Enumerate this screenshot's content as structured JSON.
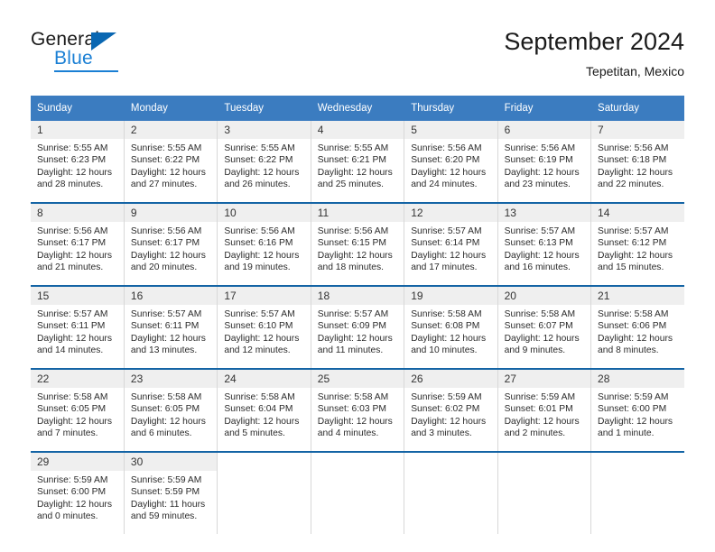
{
  "brand": {
    "name_top": "General",
    "name_bottom": "Blue",
    "triangle_color": "#0a67b2",
    "blue_color": "#1a7fd4"
  },
  "header": {
    "title": "September 2024",
    "subtitle": "Tepetitan, Mexico"
  },
  "theme": {
    "header_row_bg": "#3b7cc0",
    "header_row_text": "#ffffff",
    "week_divider": "#1464a5",
    "daynum_bg": "#efefef",
    "cell_border": "#d8d8d8"
  },
  "columns": [
    "Sunday",
    "Monday",
    "Tuesday",
    "Wednesday",
    "Thursday",
    "Friday",
    "Saturday"
  ],
  "weeks": [
    [
      {
        "day": "1",
        "sunrise": "Sunrise: 5:55 AM",
        "sunset": "Sunset: 6:23 PM",
        "daylight_1": "Daylight: 12 hours",
        "daylight_2": "and 28 minutes."
      },
      {
        "day": "2",
        "sunrise": "Sunrise: 5:55 AM",
        "sunset": "Sunset: 6:22 PM",
        "daylight_1": "Daylight: 12 hours",
        "daylight_2": "and 27 minutes."
      },
      {
        "day": "3",
        "sunrise": "Sunrise: 5:55 AM",
        "sunset": "Sunset: 6:22 PM",
        "daylight_1": "Daylight: 12 hours",
        "daylight_2": "and 26 minutes."
      },
      {
        "day": "4",
        "sunrise": "Sunrise: 5:55 AM",
        "sunset": "Sunset: 6:21 PM",
        "daylight_1": "Daylight: 12 hours",
        "daylight_2": "and 25 minutes."
      },
      {
        "day": "5",
        "sunrise": "Sunrise: 5:56 AM",
        "sunset": "Sunset: 6:20 PM",
        "daylight_1": "Daylight: 12 hours",
        "daylight_2": "and 24 minutes."
      },
      {
        "day": "6",
        "sunrise": "Sunrise: 5:56 AM",
        "sunset": "Sunset: 6:19 PM",
        "daylight_1": "Daylight: 12 hours",
        "daylight_2": "and 23 minutes."
      },
      {
        "day": "7",
        "sunrise": "Sunrise: 5:56 AM",
        "sunset": "Sunset: 6:18 PM",
        "daylight_1": "Daylight: 12 hours",
        "daylight_2": "and 22 minutes."
      }
    ],
    [
      {
        "day": "8",
        "sunrise": "Sunrise: 5:56 AM",
        "sunset": "Sunset: 6:17 PM",
        "daylight_1": "Daylight: 12 hours",
        "daylight_2": "and 21 minutes."
      },
      {
        "day": "9",
        "sunrise": "Sunrise: 5:56 AM",
        "sunset": "Sunset: 6:17 PM",
        "daylight_1": "Daylight: 12 hours",
        "daylight_2": "and 20 minutes."
      },
      {
        "day": "10",
        "sunrise": "Sunrise: 5:56 AM",
        "sunset": "Sunset: 6:16 PM",
        "daylight_1": "Daylight: 12 hours",
        "daylight_2": "and 19 minutes."
      },
      {
        "day": "11",
        "sunrise": "Sunrise: 5:56 AM",
        "sunset": "Sunset: 6:15 PM",
        "daylight_1": "Daylight: 12 hours",
        "daylight_2": "and 18 minutes."
      },
      {
        "day": "12",
        "sunrise": "Sunrise: 5:57 AM",
        "sunset": "Sunset: 6:14 PM",
        "daylight_1": "Daylight: 12 hours",
        "daylight_2": "and 17 minutes."
      },
      {
        "day": "13",
        "sunrise": "Sunrise: 5:57 AM",
        "sunset": "Sunset: 6:13 PM",
        "daylight_1": "Daylight: 12 hours",
        "daylight_2": "and 16 minutes."
      },
      {
        "day": "14",
        "sunrise": "Sunrise: 5:57 AM",
        "sunset": "Sunset: 6:12 PM",
        "daylight_1": "Daylight: 12 hours",
        "daylight_2": "and 15 minutes."
      }
    ],
    [
      {
        "day": "15",
        "sunrise": "Sunrise: 5:57 AM",
        "sunset": "Sunset: 6:11 PM",
        "daylight_1": "Daylight: 12 hours",
        "daylight_2": "and 14 minutes."
      },
      {
        "day": "16",
        "sunrise": "Sunrise: 5:57 AM",
        "sunset": "Sunset: 6:11 PM",
        "daylight_1": "Daylight: 12 hours",
        "daylight_2": "and 13 minutes."
      },
      {
        "day": "17",
        "sunrise": "Sunrise: 5:57 AM",
        "sunset": "Sunset: 6:10 PM",
        "daylight_1": "Daylight: 12 hours",
        "daylight_2": "and 12 minutes."
      },
      {
        "day": "18",
        "sunrise": "Sunrise: 5:57 AM",
        "sunset": "Sunset: 6:09 PM",
        "daylight_1": "Daylight: 12 hours",
        "daylight_2": "and 11 minutes."
      },
      {
        "day": "19",
        "sunrise": "Sunrise: 5:58 AM",
        "sunset": "Sunset: 6:08 PM",
        "daylight_1": "Daylight: 12 hours",
        "daylight_2": "and 10 minutes."
      },
      {
        "day": "20",
        "sunrise": "Sunrise: 5:58 AM",
        "sunset": "Sunset: 6:07 PM",
        "daylight_1": "Daylight: 12 hours",
        "daylight_2": "and 9 minutes."
      },
      {
        "day": "21",
        "sunrise": "Sunrise: 5:58 AM",
        "sunset": "Sunset: 6:06 PM",
        "daylight_1": "Daylight: 12 hours",
        "daylight_2": "and 8 minutes."
      }
    ],
    [
      {
        "day": "22",
        "sunrise": "Sunrise: 5:58 AM",
        "sunset": "Sunset: 6:05 PM",
        "daylight_1": "Daylight: 12 hours",
        "daylight_2": "and 7 minutes."
      },
      {
        "day": "23",
        "sunrise": "Sunrise: 5:58 AM",
        "sunset": "Sunset: 6:05 PM",
        "daylight_1": "Daylight: 12 hours",
        "daylight_2": "and 6 minutes."
      },
      {
        "day": "24",
        "sunrise": "Sunrise: 5:58 AM",
        "sunset": "Sunset: 6:04 PM",
        "daylight_1": "Daylight: 12 hours",
        "daylight_2": "and 5 minutes."
      },
      {
        "day": "25",
        "sunrise": "Sunrise: 5:58 AM",
        "sunset": "Sunset: 6:03 PM",
        "daylight_1": "Daylight: 12 hours",
        "daylight_2": "and 4 minutes."
      },
      {
        "day": "26",
        "sunrise": "Sunrise: 5:59 AM",
        "sunset": "Sunset: 6:02 PM",
        "daylight_1": "Daylight: 12 hours",
        "daylight_2": "and 3 minutes."
      },
      {
        "day": "27",
        "sunrise": "Sunrise: 5:59 AM",
        "sunset": "Sunset: 6:01 PM",
        "daylight_1": "Daylight: 12 hours",
        "daylight_2": "and 2 minutes."
      },
      {
        "day": "28",
        "sunrise": "Sunrise: 5:59 AM",
        "sunset": "Sunset: 6:00 PM",
        "daylight_1": "Daylight: 12 hours",
        "daylight_2": "and 1 minute."
      }
    ],
    [
      {
        "day": "29",
        "sunrise": "Sunrise: 5:59 AM",
        "sunset": "Sunset: 6:00 PM",
        "daylight_1": "Daylight: 12 hours",
        "daylight_2": "and 0 minutes."
      },
      {
        "day": "30",
        "sunrise": "Sunrise: 5:59 AM",
        "sunset": "Sunset: 5:59 PM",
        "daylight_1": "Daylight: 11 hours",
        "daylight_2": "and 59 minutes."
      },
      {
        "day": "",
        "sunrise": "",
        "sunset": "",
        "daylight_1": "",
        "daylight_2": ""
      },
      {
        "day": "",
        "sunrise": "",
        "sunset": "",
        "daylight_1": "",
        "daylight_2": ""
      },
      {
        "day": "",
        "sunrise": "",
        "sunset": "",
        "daylight_1": "",
        "daylight_2": ""
      },
      {
        "day": "",
        "sunrise": "",
        "sunset": "",
        "daylight_1": "",
        "daylight_2": ""
      },
      {
        "day": "",
        "sunrise": "",
        "sunset": "",
        "daylight_1": "",
        "daylight_2": ""
      }
    ]
  ]
}
